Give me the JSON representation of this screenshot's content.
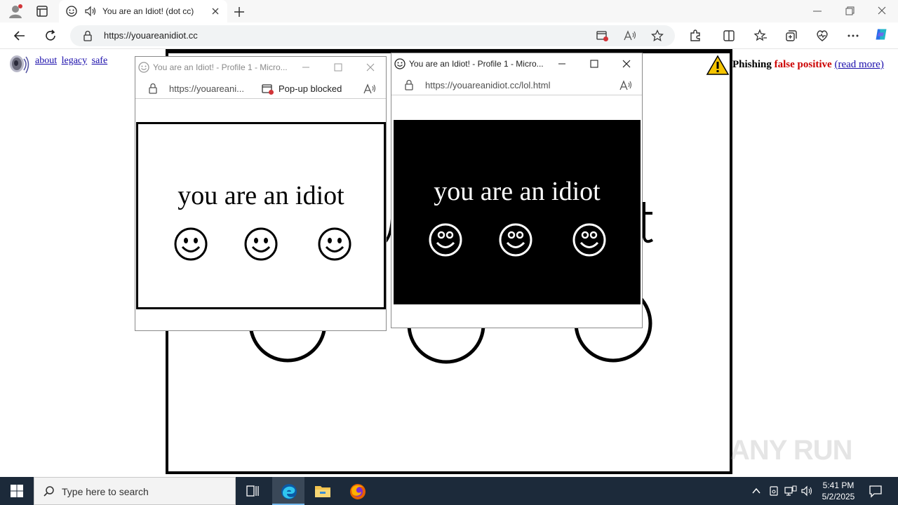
{
  "browser": {
    "tab": {
      "title": "You are an Idiot! (dot cc)"
    },
    "address_url": "https://youareanidiot.cc"
  },
  "page": {
    "nav_links": [
      "about",
      "legacy",
      "safe"
    ],
    "phishing_notice": {
      "label": "Phishing",
      "status": "false positive",
      "link": "(read more)"
    },
    "background_text": "you are an idiot"
  },
  "popup_left": {
    "title": "You are an Idiot! - Profile 1 - Micro...",
    "url": "https://youareani...",
    "blocked_label": "Pop-up blocked",
    "text": "you are an idiot"
  },
  "popup_right": {
    "title": "You are an Idiot! - Profile 1 - Micro...",
    "url": "https://youareanidiot.cc/lol.html",
    "text": "you are an idiot"
  },
  "taskbar": {
    "search_placeholder": "Type here to search",
    "time": "5:41 PM",
    "date": "5/2/2025"
  },
  "watermark": "ANY RUN",
  "colors": {
    "taskbar": "#1c2a3a",
    "accent_red": "#cc0000",
    "link": "#1a0dab",
    "edge_blue": "#0078d4"
  }
}
